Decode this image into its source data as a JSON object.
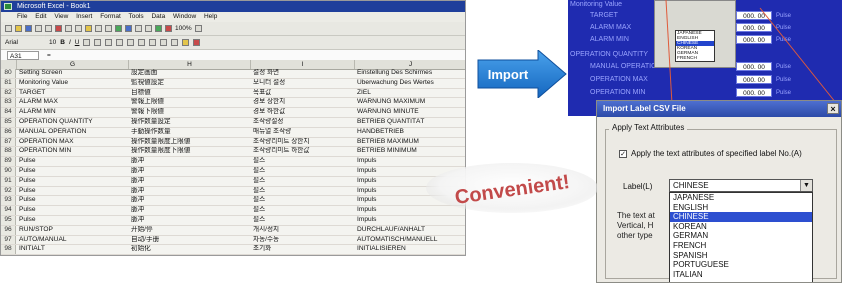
{
  "excel": {
    "title": "Microsoft Excel - Book1",
    "menu": [
      "File",
      "Edit",
      "View",
      "Insert",
      "Format",
      "Tools",
      "Data",
      "Window",
      "Help"
    ],
    "zoom": "100%",
    "font_name": "Arial",
    "font_size": "10",
    "name_box": "A31",
    "columns": [
      "G",
      "H",
      "I",
      "J"
    ],
    "rows": [
      {
        "n": "80",
        "g": "Setting Screen",
        "h": "設定画面",
        "i": "설정 화면",
        "j": "Einstellung Des Schirmes"
      },
      {
        "n": "81",
        "g": "Monitoring Value",
        "h": "監視値設定",
        "i": "모니터 설정",
        "j": "Überwachung Des Wertes"
      },
      {
        "n": "82",
        "g": "TARGET",
        "h": "目標値",
        "i": "목표값",
        "j": "ZIEL"
      },
      {
        "n": "83",
        "g": "ALARM MAX",
        "h": "警報上限値",
        "i": "경보 상한치",
        "j": "WARNUNG MAXIMUM"
      },
      {
        "n": "84",
        "g": "ALARM MIN",
        "h": "警報下限値",
        "i": "경보 하한값",
        "j": "WARNUNG MINUTE"
      },
      {
        "n": "85",
        "g": "OPERATION QUANTITY",
        "h": "操作数量設定",
        "i": "조작량설정",
        "j": "BETRIEB QUANTITÄT"
      },
      {
        "n": "86",
        "g": "MANUAL OPERATION",
        "h": "手動操作数量",
        "i": "매뉴얼 조작량",
        "j": "HANDBETRIEB"
      },
      {
        "n": "87",
        "g": "OPERATION MAX",
        "h": "操作数量限度上限値",
        "i": "조작량리미트 상한치",
        "j": "BETRIEB MAXIMUM"
      },
      {
        "n": "88",
        "g": "OPERATION MIN",
        "h": "操作数量限度下限値",
        "i": "조작량리미트 하한값",
        "j": "BETRIEB MINIMUM"
      },
      {
        "n": "89",
        "g": "Pulse",
        "h": "脈冲",
        "i": "펄스",
        "j": "Impuls"
      },
      {
        "n": "90",
        "g": "Pulse",
        "h": "脈冲",
        "i": "펄스",
        "j": "Impuls"
      },
      {
        "n": "91",
        "g": "Pulse",
        "h": "脈冲",
        "i": "펄스",
        "j": "Impuls"
      },
      {
        "n": "92",
        "g": "Pulse",
        "h": "脈冲",
        "i": "펄스",
        "j": "Impuls"
      },
      {
        "n": "93",
        "g": "Pulse",
        "h": "脈冲",
        "i": "펄스",
        "j": "Impuls"
      },
      {
        "n": "94",
        "g": "Pulse",
        "h": "脈冲",
        "i": "펄스",
        "j": "Impuls"
      },
      {
        "n": "95",
        "g": "Pulse",
        "h": "脈冲",
        "i": "펄스",
        "j": "Impuls"
      },
      {
        "n": "96",
        "g": "RUN/STOP",
        "h": "开始/停",
        "i": "개시/정지",
        "j": "DURCHLAUF/ANHALT"
      },
      {
        "n": "97",
        "g": "AUTO/MANUAL",
        "h": "自动/手册",
        "i": "자동/수동",
        "j": "AUTOMATISCH/MANUELL"
      },
      {
        "n": "98",
        "g": "INITIALT",
        "h": "初始化",
        "i": "초기화",
        "j": "INITIALISIEREN"
      }
    ]
  },
  "import_arrow": {
    "label": "Import",
    "color": "#1f7fd8"
  },
  "settings_screen": {
    "title": "Monitoring Value",
    "fields": [
      {
        "label": "TARGET",
        "value": "000. 00",
        "unit": "Pulse"
      },
      {
        "label": "ALARM MAX",
        "value": "000. 00",
        "unit": "Pulse"
      },
      {
        "label": "ALARM MIN",
        "value": "000. 00",
        "unit": "Pulse"
      }
    ],
    "section": "OPERATION QUANTITY",
    "fields2": [
      {
        "label": "MANUAL OPERATION",
        "value": "000. 00",
        "unit": "Pulse"
      },
      {
        "label": "OPERATION MAX",
        "value": "000. 00",
        "unit": "Pulse"
      },
      {
        "label": "OPERATION MIN",
        "value": "000. 00",
        "unit": "Pulse"
      }
    ],
    "mini_list": [
      "JAPANESE",
      "ENGLISH",
      "CHINESE",
      "KOREAN",
      "GERMAN",
      "FRENCH"
    ],
    "mini_selected": "CHINESE"
  },
  "dialog": {
    "title": "Import Label CSV File",
    "group_title": "Apply Text Attributes",
    "checkbox_label": "Apply the text attributes of specified label No.(A)",
    "checkbox_checked": true,
    "label_field": "Label(L)",
    "selected": "CHINESE",
    "options": [
      "JAPANESE",
      "ENGLISH",
      "CHINESE",
      "KOREAN",
      "GERMAN",
      "FRENCH",
      "SPANISH",
      "PORTUGUESE",
      "ITALIAN"
    ],
    "hidden_text": [
      "The text at",
      "Vertical, H",
      "other type"
    ],
    "close_label": "×"
  },
  "badge": {
    "text": "Convenient!",
    "color": "#c24a4a"
  },
  "colors": {
    "excel_title": "#1f3f9b",
    "settings_bg": "#1f2bb0",
    "dialog_title": "#2c4aa8",
    "highlight": "#2d4fd0"
  }
}
